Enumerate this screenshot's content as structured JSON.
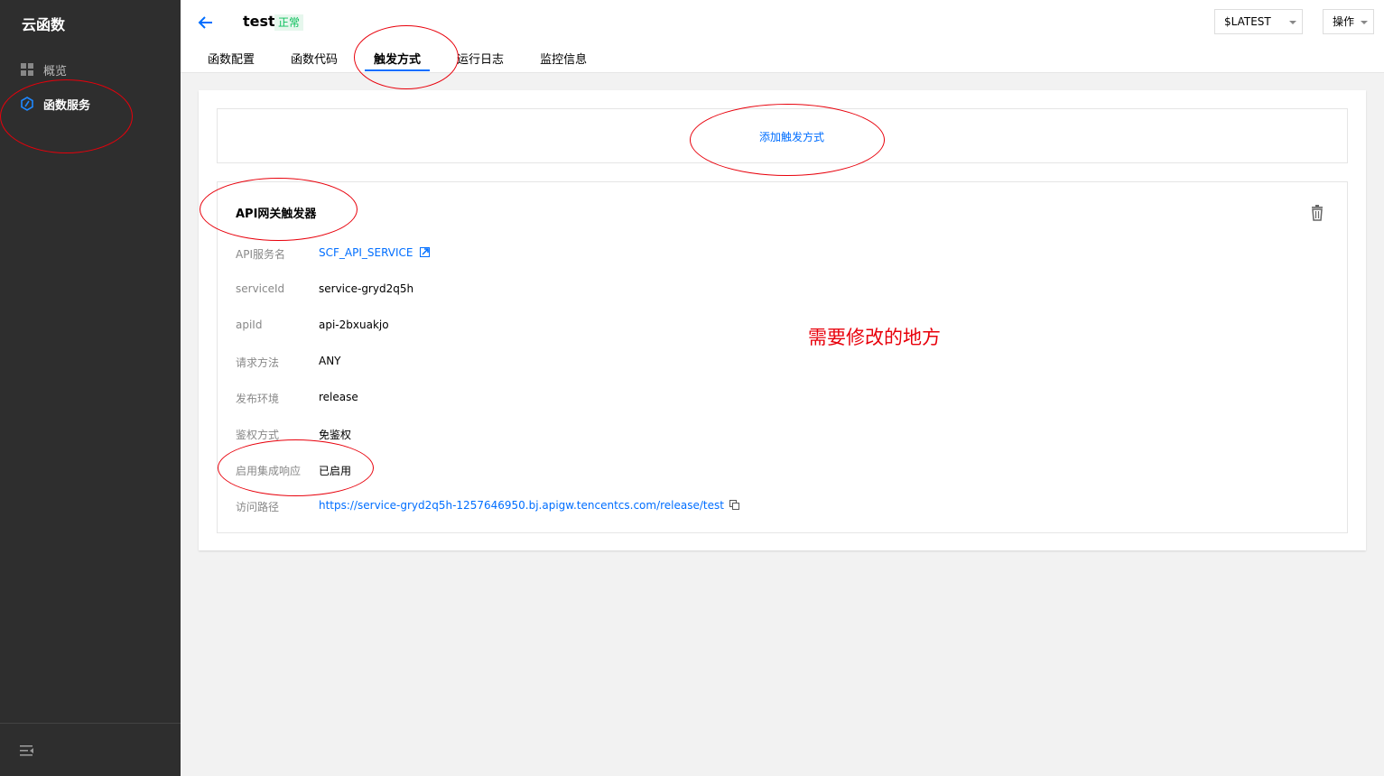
{
  "sidebar": {
    "title": "云函数",
    "items": [
      {
        "label": "概览",
        "icon": "grid-icon"
      },
      {
        "label": "函数服务",
        "icon": "function-icon"
      }
    ]
  },
  "header": {
    "function_name": "test",
    "status": "正常",
    "tabs": [
      "函数配置",
      "函数代码",
      "触发方式",
      "运行日志",
      "监控信息"
    ],
    "active_tab": "触发方式",
    "version": "$LATEST",
    "ops_label": "操作"
  },
  "main": {
    "add_trigger_label": "添加触发方式",
    "trigger": {
      "title": "API网关触发器",
      "rows": [
        {
          "label": "API服务名",
          "value": "SCF_API_SERVICE"
        },
        {
          "label": "serviceId",
          "value": "service-gryd2q5h"
        },
        {
          "label": "apiId",
          "value": "api-2bxuakjo"
        },
        {
          "label": "请求方法",
          "value": "ANY"
        },
        {
          "label": "发布环境",
          "value": "release"
        },
        {
          "label": "鉴权方式",
          "value": "免鉴权"
        },
        {
          "label": "启用集成响应",
          "value": "已启用"
        },
        {
          "label": "访问路径",
          "value": "https://service-gryd2q5h-1257646950.bj.apigw.tencentcs.com/release/test"
        }
      ]
    }
  },
  "annotation": {
    "text": "需要修改的地方",
    "color": "#e8000b"
  },
  "colors": {
    "accent": "#006eff",
    "status_green": "#0abf5b",
    "sidebar_bg": "#2e2e2e"
  }
}
